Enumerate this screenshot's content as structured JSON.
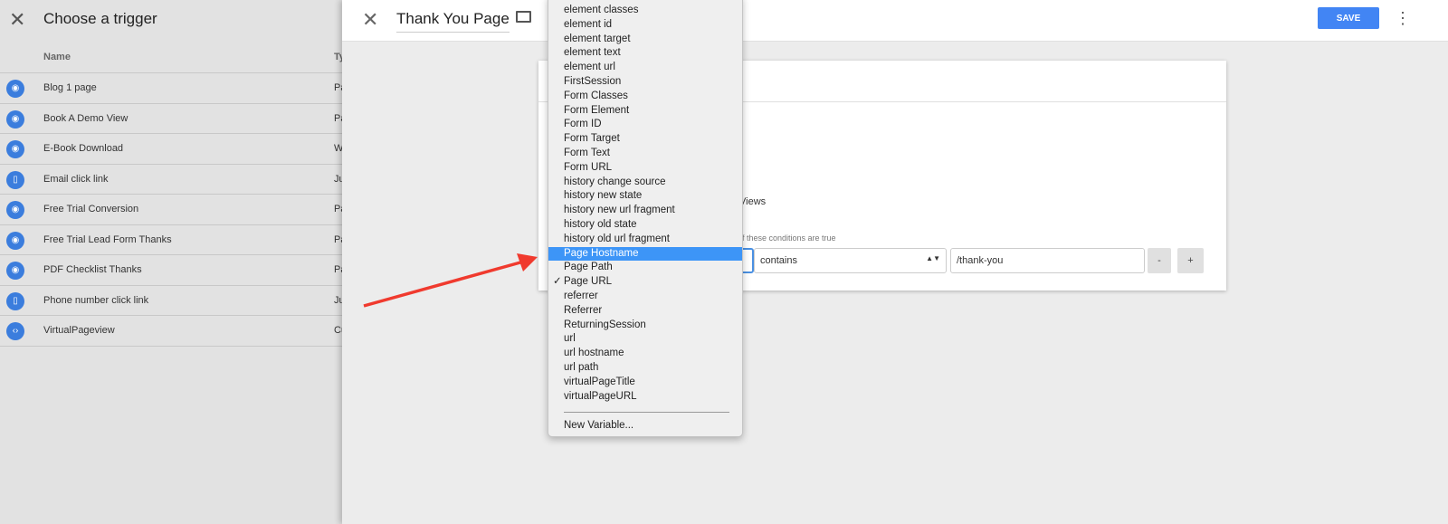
{
  "left": {
    "close": "✕",
    "title": "Choose a trigger",
    "col_name": "Name",
    "col_type": "Ty",
    "rows": [
      {
        "name": "Blog 1 page",
        "type": "Pa",
        "icon": "eye-icon"
      },
      {
        "name": "Book A Demo View",
        "type": "Pa",
        "icon": "eye-icon"
      },
      {
        "name": "E-Book Download",
        "type": "W",
        "icon": "eye-icon"
      },
      {
        "name": "Email click link",
        "type": "Ju",
        "icon": "mouse-icon"
      },
      {
        "name": "Free Trial Conversion",
        "type": "Pa",
        "icon": "eye-icon"
      },
      {
        "name": "Free Trial Lead Form Thanks",
        "type": "Pa",
        "icon": "eye-icon"
      },
      {
        "name": "PDF Checklist Thanks",
        "type": "Pa",
        "icon": "eye-icon"
      },
      {
        "name": "Phone number click link",
        "type": "Ju",
        "icon": "mouse-icon"
      },
      {
        "name": "VirtualPageview",
        "type": "Cu",
        "icon": "code-icon"
      }
    ]
  },
  "header": {
    "close": "✕",
    "title": "Thank You Page",
    "save": "SAVE",
    "more": "⋮"
  },
  "card": {
    "views_fragment": "Views",
    "conditions_fragment": "f these conditions are true",
    "operator": "contains",
    "value": "/thank-you",
    "minus": "-",
    "plus": "+"
  },
  "dropdown": {
    "items": [
      "element classes",
      "element id",
      "element target",
      "element text",
      "element url",
      "FirstSession",
      "Form Classes",
      "Form Element",
      "Form ID",
      "Form Target",
      "Form Text",
      "Form URL",
      "history change source",
      "history new state",
      "history new url fragment",
      "history old state",
      "history old url fragment",
      "Page Hostname",
      "Page Path",
      "Page URL",
      "referrer",
      "Referrer",
      "ReturningSession",
      "url",
      "url hostname",
      "url path",
      "virtualPageTitle",
      "virtualPageURL"
    ],
    "highlighted": "Page Hostname",
    "checked": "Page URL",
    "check_mark": "✓",
    "new_variable": "New Variable..."
  },
  "colors": {
    "accent": "#4285f4",
    "highlight": "#3d95f7",
    "arrow": "#f03a2e"
  }
}
